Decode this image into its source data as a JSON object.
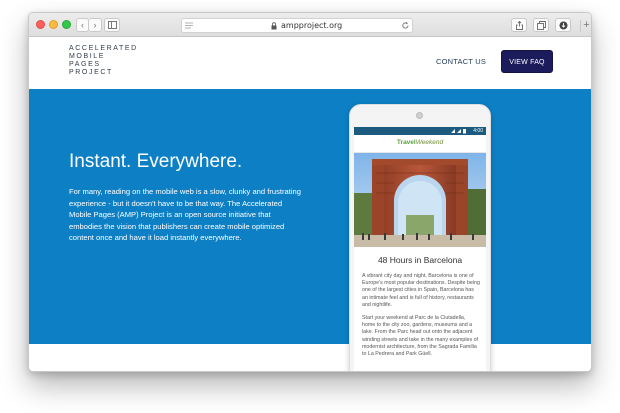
{
  "browser": {
    "url": "ampproject.org",
    "back_glyph": "‹",
    "forward_glyph": "›",
    "new_tab_glyph": "+"
  },
  "site": {
    "logo_lines": [
      "ACCELERATED",
      "MOBILE",
      "PAGES",
      "PROJECT"
    ],
    "nav": {
      "contact": "CONTACT US",
      "faq_button": "VIEW FAQ"
    },
    "hero": {
      "title": "Instant. Everywhere.",
      "body": "For many, reading on the mobile web is a slow, clunky and frustrating experience - but it doesn't have to be that way. The Accelerated Mobile Pages (AMP) Project is an open source initiative that embodies the vision that publishers can create mobile optimized content once and have it load instantly everywhere."
    }
  },
  "phone": {
    "status_time": "4:00",
    "brand_part1": "Travel",
    "brand_part2": "Weekend",
    "article_title": "48 Hours in Barcelona",
    "paragraphs": [
      "A vibrant city day and night, Barcelona is one of Europe's most popular destinations. Despite being one of the largest cities in Spain, Barcelona has an intimate feel and is full of history, restaurants and nightlife.",
      "Start your weekend at Parc de la Ciutadella, home to the city zoo, gardens, museums and a lake. From the Parc head out onto the adjacent winding streets and take in the many examples of modernist architecture, from the Sagrada Familia to La Pedrera and Park Güell."
    ]
  },
  "colors": {
    "hero_blue": "#0d7fc4",
    "faq_button": "#1c1c5c",
    "status_bar": "#1c5a80",
    "brand_green": "#5a9f3f"
  }
}
